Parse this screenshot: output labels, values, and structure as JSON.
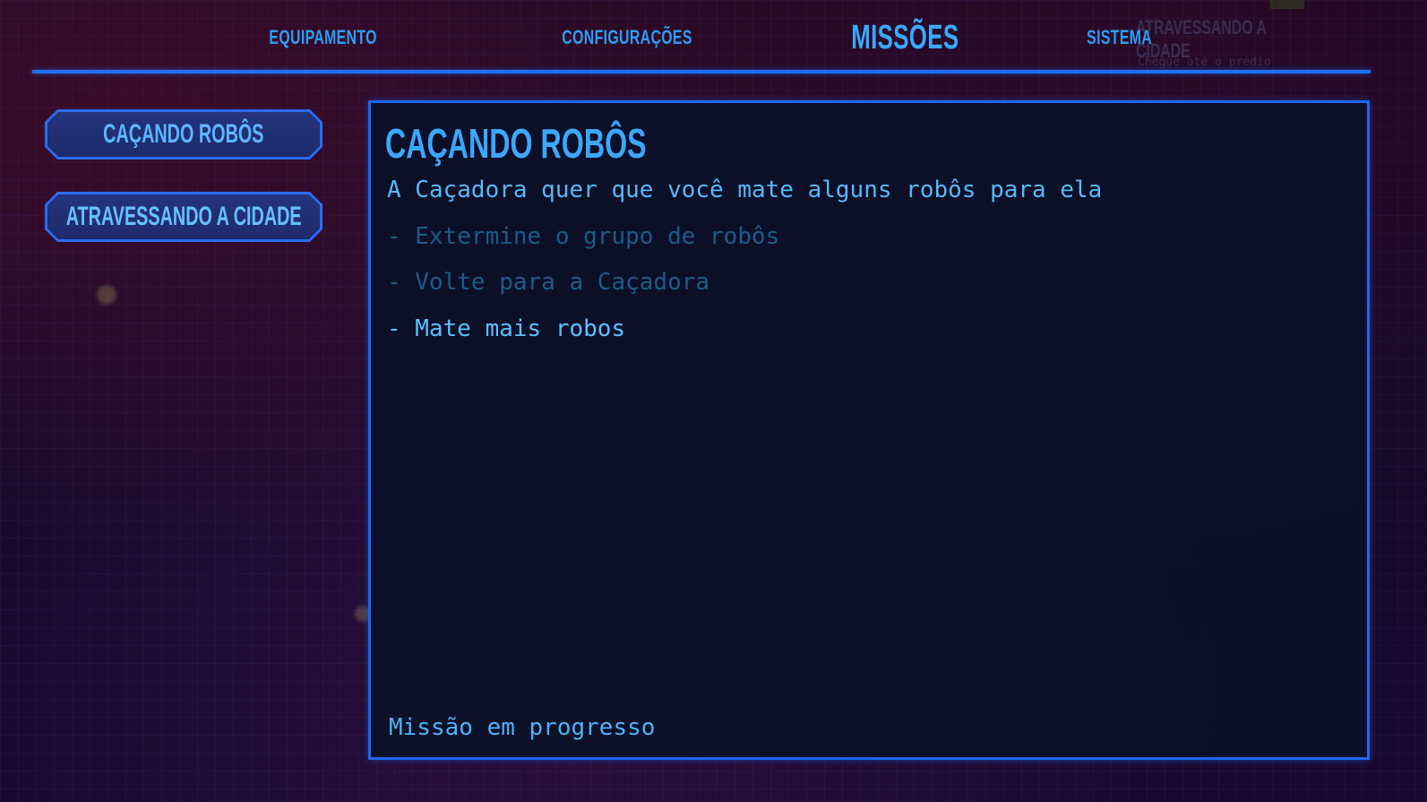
{
  "nav": {
    "tabs": [
      {
        "label": "EQUIPAMENTO",
        "active": false
      },
      {
        "label": "CONFIGURAÇÕES",
        "active": false
      },
      {
        "label": "MISSÕES",
        "active": true
      },
      {
        "label": "SISTEMA",
        "active": false
      }
    ]
  },
  "background_hud": {
    "title": "ATRAVESSANDO A CIDADE",
    "subtitle": "Chegue até o prédio"
  },
  "missions": {
    "items": [
      {
        "label": "CAÇANDO ROBÔS",
        "selected": true
      },
      {
        "label": "ATRAVESSANDO A CIDADE",
        "selected": false
      }
    ]
  },
  "detail": {
    "title": "CAÇANDO ROBÔS",
    "description": "A Caçadora quer que você mate alguns robôs para ela",
    "objectives": [
      {
        "text": "- Extermine o grupo de robôs",
        "status": "done"
      },
      {
        "text": "- Volte para a Caçadora",
        "status": "done"
      },
      {
        "text": "- Mate mais robos",
        "status": "current"
      }
    ],
    "status": "Missão em progresso"
  },
  "colors": {
    "accent": "#3aa8ff",
    "frame": "#1e66f0",
    "objective_done": "#1d5b86",
    "objective_current": "#5cc0ff"
  }
}
